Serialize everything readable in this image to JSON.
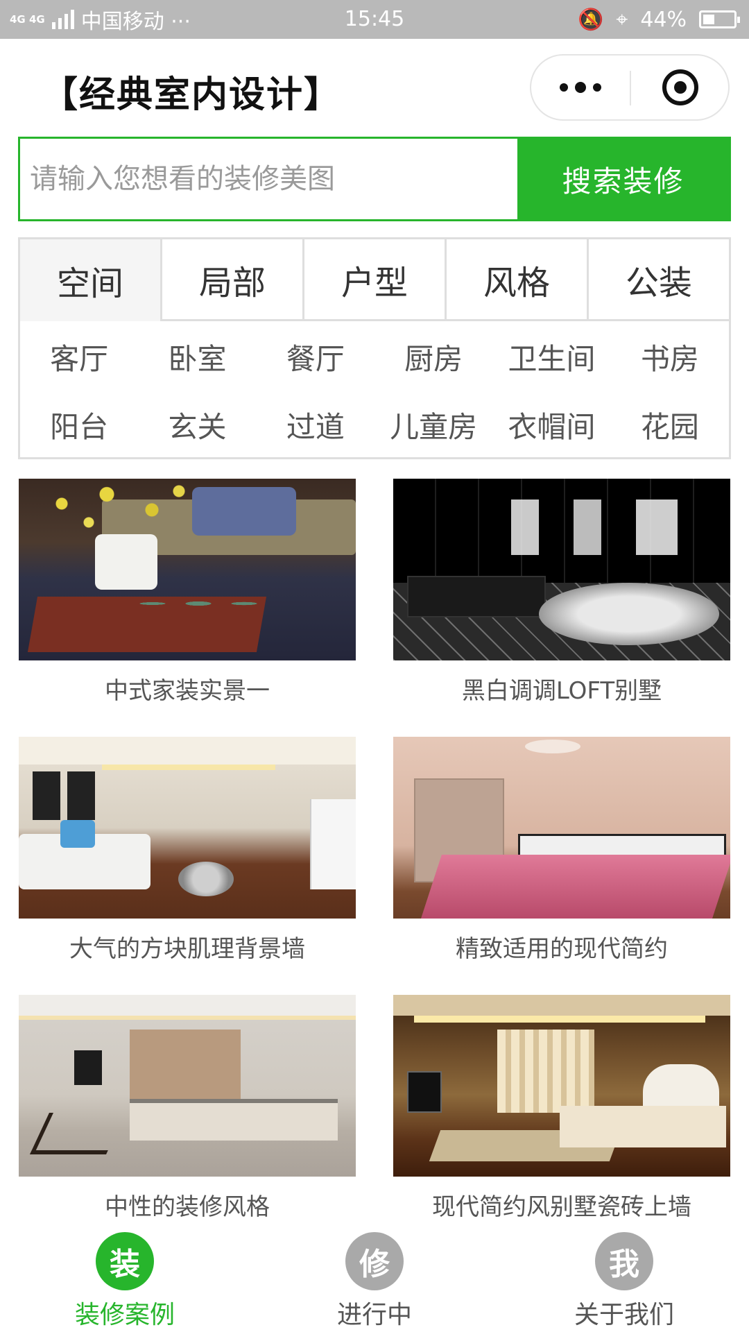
{
  "status_bar": {
    "network": "4G 4G",
    "carrier": "中国移动 ···",
    "time": "15:45",
    "battery": "44%"
  },
  "header": {
    "title": "【经典室内设计】"
  },
  "search": {
    "placeholder": "请输入您想看的装修美图",
    "button_label": "搜索装修"
  },
  "category_tabs": [
    {
      "label": "空间"
    },
    {
      "label": "局部"
    },
    {
      "label": "户型"
    },
    {
      "label": "风格"
    },
    {
      "label": "公装"
    }
  ],
  "categories": [
    {
      "label": "客厅"
    },
    {
      "label": "卧室"
    },
    {
      "label": "餐厅"
    },
    {
      "label": "厨房"
    },
    {
      "label": "卫生间"
    },
    {
      "label": "书房"
    },
    {
      "label": "阳台"
    },
    {
      "label": "玄关"
    },
    {
      "label": "过道"
    },
    {
      "label": "儿童房"
    },
    {
      "label": "衣帽间"
    },
    {
      "label": "花园"
    }
  ],
  "gallery": [
    {
      "caption": "中式家装实景一"
    },
    {
      "caption": "黑白调调LOFT别墅"
    },
    {
      "caption": "大气的方块肌理背景墙"
    },
    {
      "caption": "精致适用的现代简约"
    },
    {
      "caption": "中性的装修风格"
    },
    {
      "caption": "现代简约风别墅瓷砖上墙"
    }
  ],
  "tabbar": [
    {
      "icon_char": "装",
      "label": "装修案例",
      "active": true
    },
    {
      "icon_char": "修",
      "label": "进行中",
      "active": false
    },
    {
      "icon_char": "我",
      "label": "关于我们",
      "active": false
    }
  ],
  "colors": {
    "accent": "#27b52c",
    "status_bar_bg": "#b9b9b9",
    "inactive_icon": "#a9a9a9"
  }
}
